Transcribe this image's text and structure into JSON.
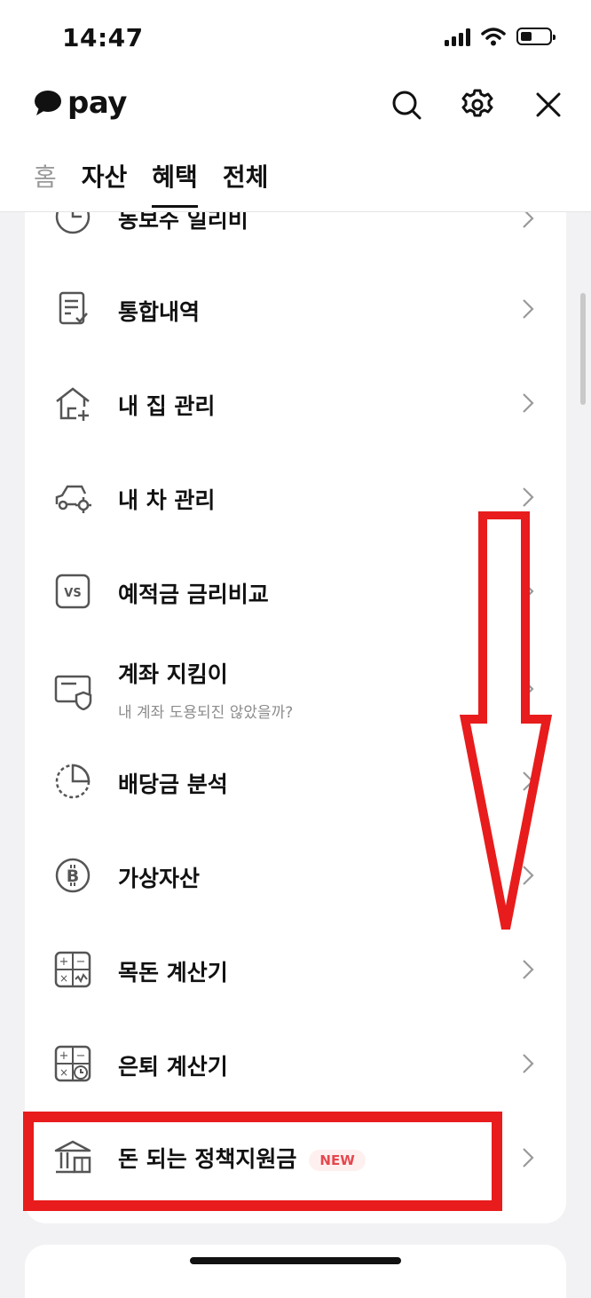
{
  "status_bar": {
    "time": "14:47"
  },
  "header": {
    "brand": "pay"
  },
  "tabs": [
    {
      "label": "홈",
      "state": "dim"
    },
    {
      "label": "자산",
      "state": "normal"
    },
    {
      "label": "혜택",
      "state": "active"
    },
    {
      "label": "전체",
      "state": "normal"
    }
  ],
  "menu": {
    "partial_item_label": "동보주 일리비",
    "items": [
      {
        "label": "통합내역",
        "icon": "document-check-icon"
      },
      {
        "label": "내 집 관리",
        "icon": "house-plus-icon"
      },
      {
        "label": "내 차 관리",
        "icon": "car-gear-icon"
      },
      {
        "label": "예적금 금리비교",
        "icon": "vs-icon"
      },
      {
        "label": "계좌 지킴이",
        "sublabel": "내 계좌 도용되진 않았을까?",
        "icon": "account-shield-icon"
      },
      {
        "label": "배당금 분석",
        "icon": "pie-chart-icon"
      },
      {
        "label": "가상자산",
        "icon": "bitcoin-icon"
      },
      {
        "label": "목돈 계산기",
        "icon": "calculator-chart-icon"
      },
      {
        "label": "은퇴 계산기",
        "icon": "calculator-clock-icon"
      },
      {
        "label": "돈 되는 정책지원금",
        "badge": "NEW",
        "icon": "government-building-icon"
      }
    ]
  },
  "colors": {
    "annotation_red": "#e81c1c",
    "badge_red": "#e5484d",
    "badge_bg": "#fff0f0"
  }
}
